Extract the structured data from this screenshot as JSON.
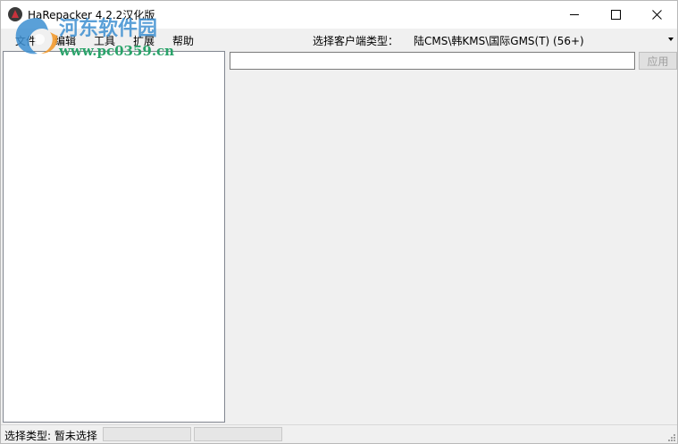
{
  "window": {
    "title": "HaRepacker 4.2.2汉化版"
  },
  "menu": {
    "items": [
      "文件",
      "编辑",
      "工具",
      "扩展",
      "帮助"
    ]
  },
  "client": {
    "label": "选择客户端类型：",
    "selected": "陆CMS\\韩KMS\\国际GMS(T) (56+)"
  },
  "search": {
    "value": "",
    "placeholder": ""
  },
  "apply": {
    "label": "应用"
  },
  "status": {
    "text": "选择类型: 暂未选择"
  },
  "watermark": {
    "brand": "河东软件园",
    "url": "www.pc0359.cn"
  },
  "colors": {
    "watermark_blue": "#3d8fd1",
    "watermark_green": "#2aa36a"
  }
}
